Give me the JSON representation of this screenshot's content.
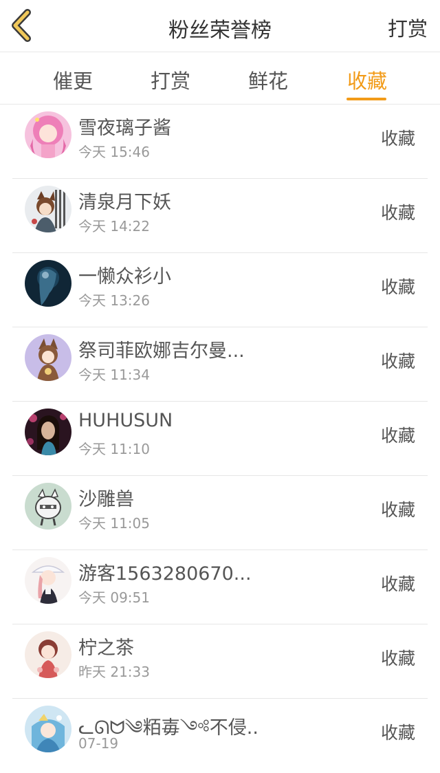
{
  "header": {
    "title": "粉丝荣誉榜",
    "right_action": "打赏"
  },
  "tabs": [
    {
      "label": "催更",
      "active": false
    },
    {
      "label": "打赏",
      "active": false
    },
    {
      "label": "鲜花",
      "active": false
    },
    {
      "label": "收藏",
      "active": true
    }
  ],
  "colors": {
    "accent": "#f29b18",
    "back_icon": "#f0c85a",
    "back_icon_outline": "#3a3a3a"
  },
  "fans": [
    {
      "name": "雪夜璃子酱",
      "time": "今天 15:46",
      "action": "收藏"
    },
    {
      "name": "清泉月下妖",
      "time": "今天 14:22",
      "action": "收藏"
    },
    {
      "name": "一懒众衫小",
      "time": "今天 13:26",
      "action": "收藏"
    },
    {
      "name": "祭司菲欧娜吉尔曼...",
      "time": "今天 11:34",
      "action": "收藏"
    },
    {
      "name": "HUHUSUN",
      "time": "今天 11:10",
      "action": "收藏"
    },
    {
      "name": "沙雕兽",
      "time": "今天 11:05",
      "action": "收藏"
    },
    {
      "name": "游客1563280670...",
      "time": "今天 09:51",
      "action": "收藏"
    },
    {
      "name": "柠之茶",
      "time": "昨天 21:33",
      "action": "收藏"
    },
    {
      "name": "ᓚᘏᗢ༄粨毐༺不侵...",
      "time": "07-19",
      "action": "收藏"
    }
  ]
}
